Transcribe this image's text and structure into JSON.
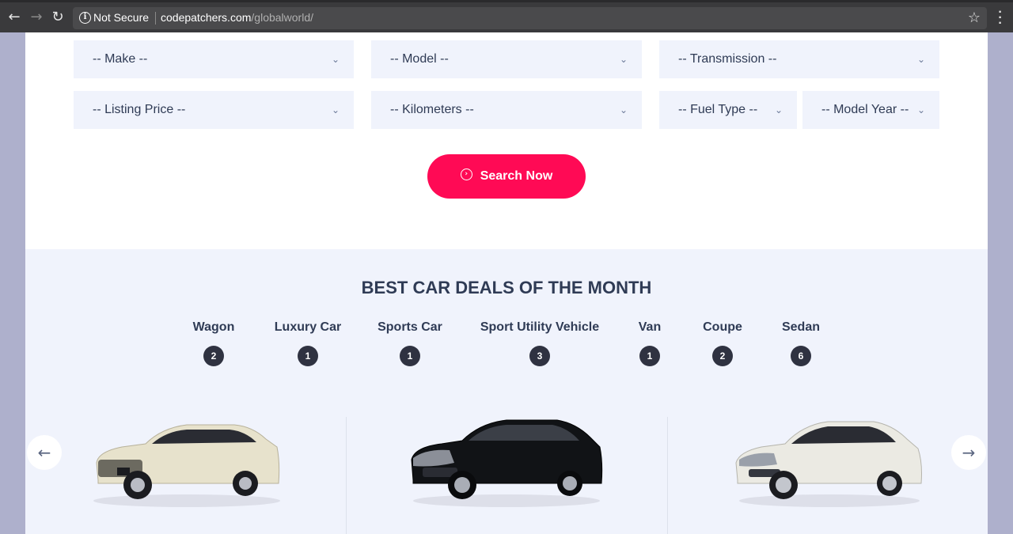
{
  "browser": {
    "back_icon": "arrow-left-icon",
    "forward_icon": "arrow-right-icon",
    "reload_icon": "reload-icon",
    "security_label": "Not Secure",
    "url_host": "codepatchers.com",
    "url_path": "/globalworld/",
    "bookmark_icon": "star-icon",
    "menu_icon": "more-vertical-icon"
  },
  "search": {
    "fields": [
      {
        "label": "-- Make --"
      },
      {
        "label": "-- Model --"
      },
      {
        "label": "-- Transmission --"
      },
      {
        "label": "-- Listing Price --"
      },
      {
        "label": "-- Kilometers --"
      },
      {
        "label": "-- Fuel Type --"
      },
      {
        "label": "-- Model Year --"
      }
    ],
    "button_label": "Search Now",
    "accent_color": "#ff0a55"
  },
  "deals": {
    "title": "BEST CAR DEALS OF THE MONTH",
    "categories": [
      {
        "label": "Wagon",
        "count": "2"
      },
      {
        "label": "Luxury Car",
        "count": "1"
      },
      {
        "label": "Sports Car",
        "count": "1"
      },
      {
        "label": "Sport Utility Vehicle",
        "count": "3"
      },
      {
        "label": "Van",
        "count": "1"
      },
      {
        "label": "Coupe",
        "count": "2"
      },
      {
        "label": "Sedan",
        "count": "6"
      }
    ],
    "cars": [
      {
        "color": "#e7e2cc"
      },
      {
        "color": "#111316"
      },
      {
        "color": "#ebeae3"
      }
    ],
    "prev_icon": "arrow-left-icon",
    "next_icon": "arrow-right-icon"
  }
}
